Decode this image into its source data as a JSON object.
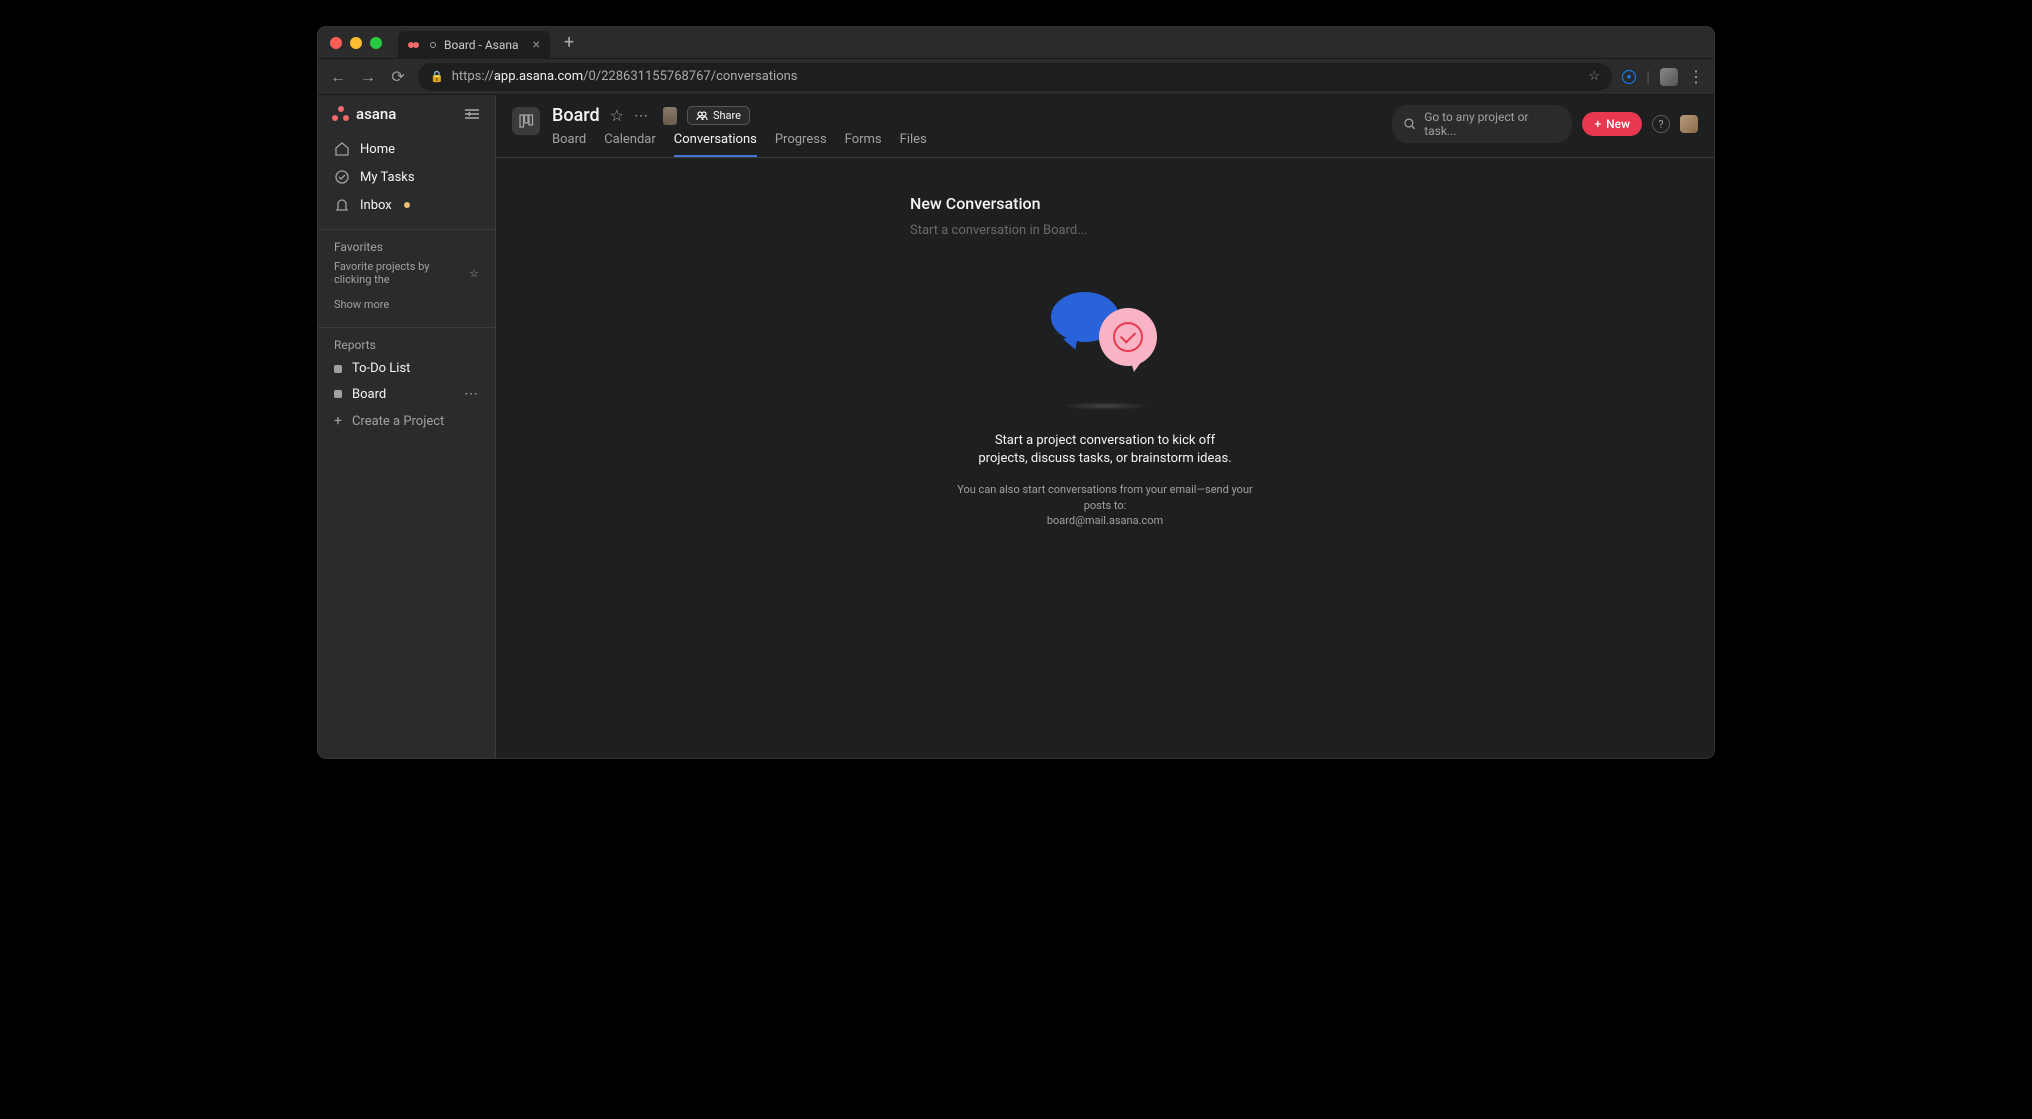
{
  "browser": {
    "tab_title": "Board - Asana",
    "url_prefix": "https://",
    "url_domain": "app.asana.com",
    "url_path": "/0/228631155768767/conversations"
  },
  "sidebar": {
    "logo_text": "asana",
    "nav": [
      {
        "label": "Home"
      },
      {
        "label": "My Tasks"
      },
      {
        "label": "Inbox"
      }
    ],
    "favorites_header": "Favorites",
    "favorites_hint": "Favorite projects by clicking the",
    "show_more": "Show more",
    "reports_header": "Reports",
    "projects": [
      {
        "label": "To-Do List"
      },
      {
        "label": "Board"
      }
    ],
    "create_project": "Create a Project"
  },
  "header": {
    "project_title": "Board",
    "share_label": "Share",
    "tabs": [
      {
        "label": "Board"
      },
      {
        "label": "Calendar"
      },
      {
        "label": "Conversations",
        "active": true
      },
      {
        "label": "Progress"
      },
      {
        "label": "Forms"
      },
      {
        "label": "Files"
      }
    ],
    "search_placeholder": "Go to any project or task...",
    "new_label": "New",
    "help_label": "?"
  },
  "content": {
    "new_conversation_title": "New Conversation",
    "new_conversation_placeholder": "Start a conversation in Board...",
    "empty_line1": "Start a project conversation to kick off projects, discuss tasks, or brainstorm ideas.",
    "empty_line2_prefix": "You can also start conversations from your email—send your posts to:",
    "empty_email": "board@mail.asana.com"
  }
}
